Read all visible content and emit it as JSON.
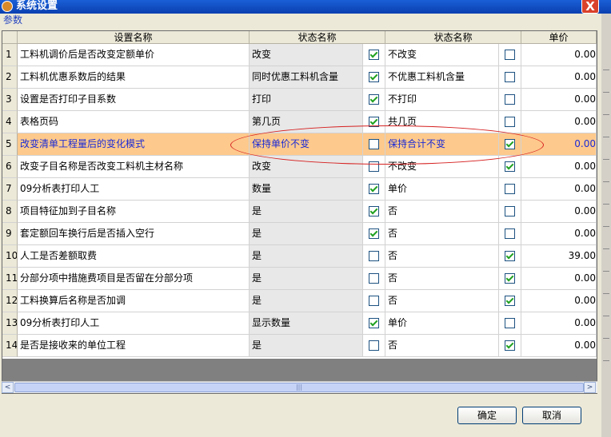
{
  "window": {
    "title": "系统设置",
    "close_label": "X"
  },
  "section_label": "参数",
  "columns": [
    "设置名称",
    "状态名称",
    "状态名称",
    "单价"
  ],
  "rows": [
    {
      "n": "1",
      "name": "工料机调价后是否改变定额单价",
      "s1": "改变",
      "c1": true,
      "s2": "不改变",
      "c2": false,
      "price": "0.00"
    },
    {
      "n": "2",
      "name": "工料机优惠系数后的结果",
      "s1": "同时优惠工料机含量",
      "c1": true,
      "s2": "不优惠工料机含量",
      "c2": false,
      "price": "0.00"
    },
    {
      "n": "3",
      "name": "设置是否打印子目系数",
      "s1": "打印",
      "c1": true,
      "s2": "不打印",
      "c2": false,
      "price": "0.00"
    },
    {
      "n": "4",
      "name": "表格页码",
      "s1": "第几页",
      "c1": true,
      "s2": "共几页",
      "c2": false,
      "price": "0.00"
    },
    {
      "n": "5",
      "name": "改变清单工程量后的变化模式",
      "s1": "保持单价不变",
      "c1": false,
      "s2": "保持合计不变",
      "c2": true,
      "price": "0.00"
    },
    {
      "n": "6",
      "name": "改变子目名称是否改变工料机主材名称",
      "s1": "改变",
      "c1": false,
      "s2": "不改变",
      "c2": true,
      "price": "0.00"
    },
    {
      "n": "7",
      "name": "09分析表打印人工",
      "s1": "数量",
      "c1": true,
      "s2": "单价",
      "c2": false,
      "price": "0.00"
    },
    {
      "n": "8",
      "name": "项目特征加到子目名称",
      "s1": "是",
      "c1": true,
      "s2": "否",
      "c2": false,
      "price": "0.00"
    },
    {
      "n": "9",
      "name": "套定额回车换行后是否插入空行",
      "s1": "是",
      "c1": true,
      "s2": "否",
      "c2": false,
      "price": "0.00"
    },
    {
      "n": "10",
      "name": "人工是否差额取费",
      "s1": "是",
      "c1": false,
      "s2": "否",
      "c2": true,
      "price": "39.00"
    },
    {
      "n": "11",
      "name": "分部分项中措施费项目是否留在分部分项",
      "s1": "是",
      "c1": false,
      "s2": "否",
      "c2": true,
      "price": "0.00"
    },
    {
      "n": "12",
      "name": "工料换算后名称是否加调",
      "s1": "是",
      "c1": false,
      "s2": "否",
      "c2": true,
      "price": "0.00"
    },
    {
      "n": "13",
      "name": "09分析表打印人工",
      "s1": "显示数量",
      "c1": true,
      "s2": "单价",
      "c2": false,
      "price": "0.00"
    },
    {
      "n": "14",
      "name": "是否是接收来的单位工程",
      "s1": "是",
      "c1": false,
      "s2": "否",
      "c2": true,
      "price": "0.00"
    }
  ],
  "selected_row": 5,
  "scroll": {
    "left_arrow": "<",
    "right_arrow": ">",
    "thumb_grip": "|||"
  },
  "buttons": {
    "ok": "确定",
    "cancel": "取消"
  },
  "colors": {
    "title_bar": "#0a3fb0",
    "selected_row": "#fec98c",
    "selected_text": "#1a2bd6",
    "highlight_oval": "#d62020",
    "check": "#21a121"
  }
}
